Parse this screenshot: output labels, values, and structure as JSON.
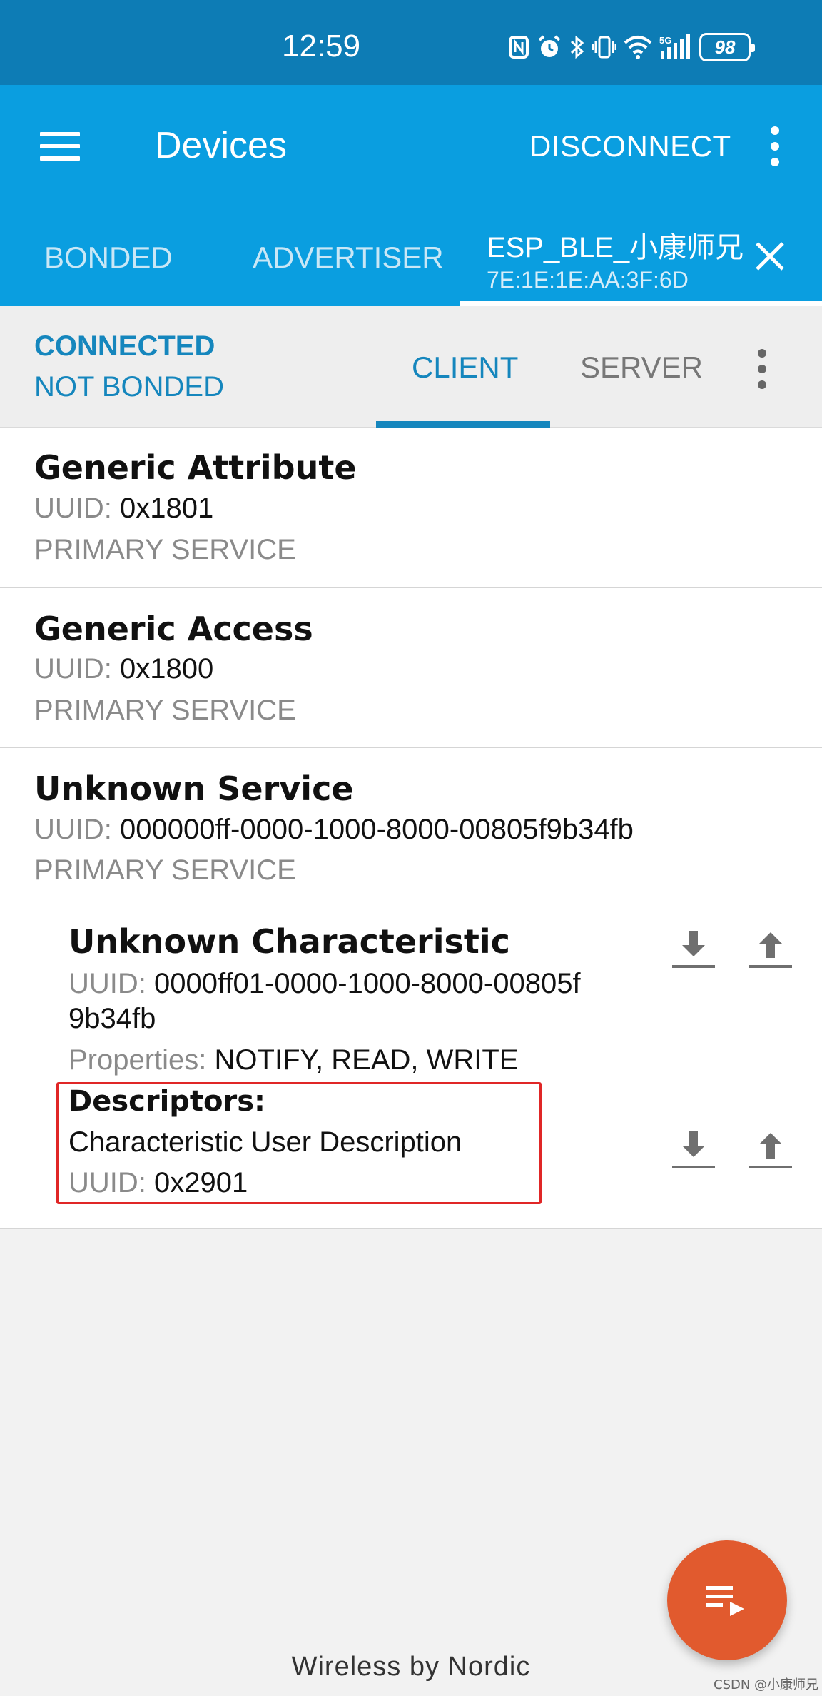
{
  "status_bar": {
    "time": "12:59",
    "battery": "98"
  },
  "toolbar": {
    "title": "Devices",
    "disconnect_label": "DISCONNECT"
  },
  "tabs": {
    "bonded": "BONDED",
    "advertiser": "ADVERTISER",
    "device_name": "ESP_BLE_小康师兄",
    "device_address": "7E:1E:1E:AA:3F:6D"
  },
  "connection": {
    "state": "CONNECTED",
    "bond_state": "NOT BONDED"
  },
  "subtabs": {
    "client": "CLIENT",
    "server": "SERVER"
  },
  "uuid_label": "UUID:",
  "services": [
    {
      "name": "Generic Attribute",
      "uuid": "0x1801",
      "type": "PRIMARY SERVICE"
    },
    {
      "name": "Generic Access",
      "uuid": "0x1800",
      "type": "PRIMARY SERVICE"
    },
    {
      "name": "Unknown Service",
      "uuid": "000000ff-0000-1000-8000-00805f9b34fb",
      "type": "PRIMARY SERVICE"
    }
  ],
  "characteristic": {
    "name": "Unknown Characteristic",
    "uuid_line1": "0000ff01-0000-1000-8000-00805f",
    "uuid_line2": "9b34fb",
    "properties_label": "Properties:",
    "properties": "NOTIFY, READ, WRITE",
    "descriptors_label": "Descriptors:",
    "descriptor_name": "Characteristic User Description",
    "descriptor_uuid": "0x2901"
  },
  "footer": "Wireless by Nordic",
  "watermark": "CSDN @小康师兄",
  "colors": {
    "status_bar": "#0d7cb5",
    "toolbar": "#0a9ee0",
    "accent": "#1586bd",
    "fab": "#e15a2e",
    "highlight": "#e02626"
  }
}
